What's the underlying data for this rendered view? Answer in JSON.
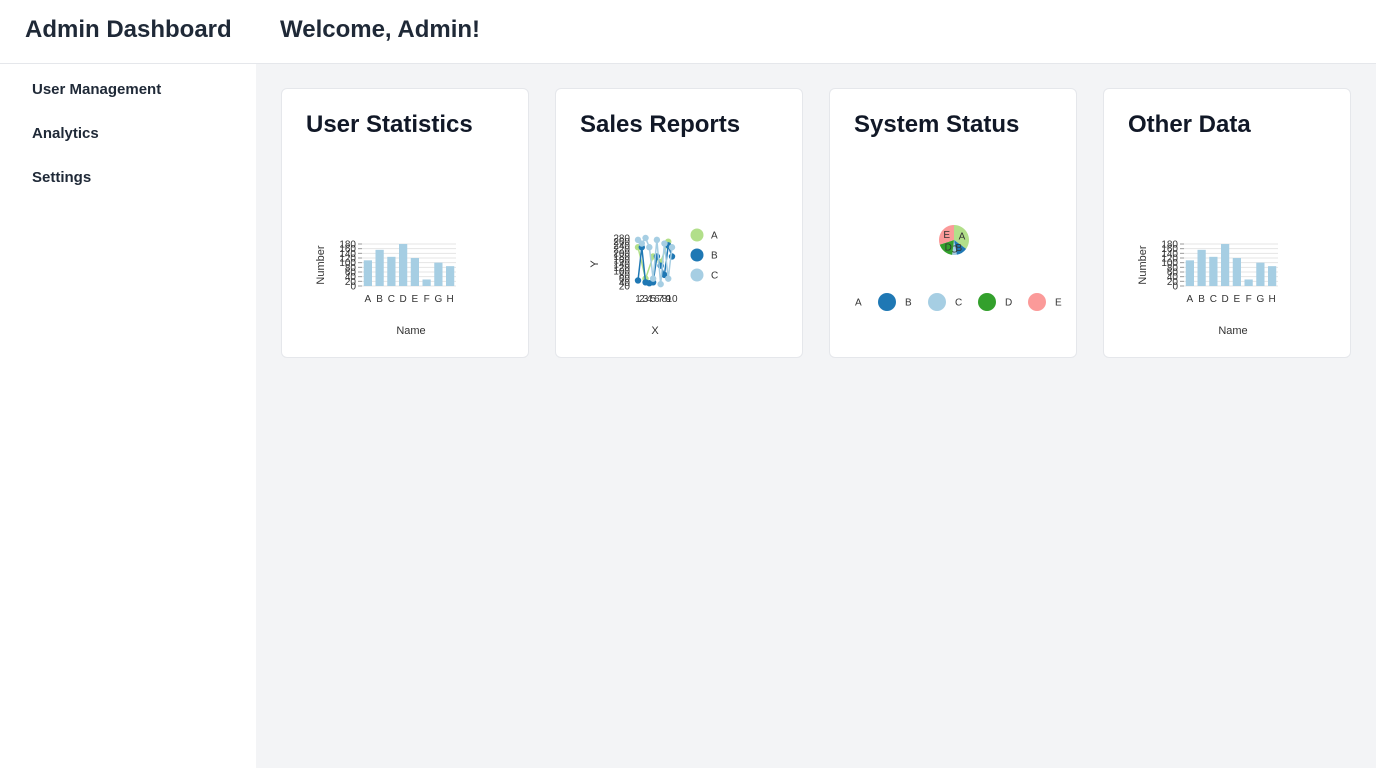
{
  "header": {
    "app_title": "Admin Dashboard",
    "welcome": "Welcome, Admin!"
  },
  "sidebar": {
    "items": [
      {
        "label": "User Management"
      },
      {
        "label": "Analytics"
      },
      {
        "label": "Settings"
      }
    ]
  },
  "cards": [
    {
      "title": "User Statistics"
    },
    {
      "title": "Sales Reports"
    },
    {
      "title": "System Status"
    },
    {
      "title": "Other Data"
    }
  ],
  "colors": {
    "bar": "#a6cee3",
    "A": "#b2df8a",
    "B": "#1f78b4",
    "C": "#a6cee3",
    "D": "#33a02c",
    "E": "#fb9a99"
  },
  "chart_data": [
    {
      "type": "bar",
      "title": "",
      "xlabel": "Name",
      "ylabel": "Number",
      "categories": [
        "A",
        "B",
        "C",
        "D",
        "E",
        "F",
        "G",
        "H"
      ],
      "values": [
        110,
        155,
        125,
        180,
        120,
        28,
        100,
        85
      ],
      "ylim": [
        0,
        180
      ],
      "yticks": [
        0,
        20,
        40,
        60,
        80,
        100,
        120,
        140,
        160,
        180
      ],
      "grid": true
    },
    {
      "type": "scatter",
      "title": "",
      "xlabel": "X",
      "ylabel": "Y",
      "xticks": [
        1,
        2,
        3,
        4,
        5,
        6,
        7,
        8,
        9,
        10
      ],
      "yticks": [
        20,
        40,
        60,
        80,
        100,
        120,
        140,
        160,
        180,
        200,
        220,
        240,
        260,
        280
      ],
      "ylim": [
        20,
        280
      ],
      "legend": [
        "A",
        "B",
        "C"
      ],
      "series": [
        {
          "name": "A",
          "x": [
            1,
            3,
            5,
            7,
            9
          ],
          "y": [
            230,
            60,
            180,
            150,
            260
          ]
        },
        {
          "name": "B",
          "x": [
            1,
            2,
            3,
            4,
            5,
            6,
            7,
            8,
            9,
            10
          ],
          "y": [
            50,
            230,
            40,
            35,
            40,
            180,
            130,
            80,
            240,
            180
          ]
        },
        {
          "name": "C",
          "x": [
            1,
            2,
            3,
            4,
            5,
            6,
            7,
            8,
            9,
            10
          ],
          "y": [
            270,
            250,
            280,
            230,
            60,
            270,
            30,
            250,
            60,
            230
          ]
        }
      ]
    },
    {
      "type": "pie",
      "title": "",
      "labels": [
        "A",
        "B",
        "C",
        "D",
        "E"
      ],
      "values": [
        35,
        12,
        5,
        18,
        30
      ],
      "legend": [
        "A",
        "B",
        "C",
        "D",
        "E"
      ],
      "legend_position": "bottom"
    },
    {
      "type": "bar",
      "title": "",
      "xlabel": "Name",
      "ylabel": "Number",
      "categories": [
        "A",
        "B",
        "C",
        "D",
        "E",
        "F",
        "G",
        "H"
      ],
      "values": [
        110,
        155,
        125,
        180,
        120,
        28,
        100,
        85
      ],
      "ylim": [
        0,
        180
      ],
      "yticks": [
        0,
        20,
        40,
        60,
        80,
        100,
        120,
        140,
        160,
        180
      ],
      "grid": true
    }
  ]
}
